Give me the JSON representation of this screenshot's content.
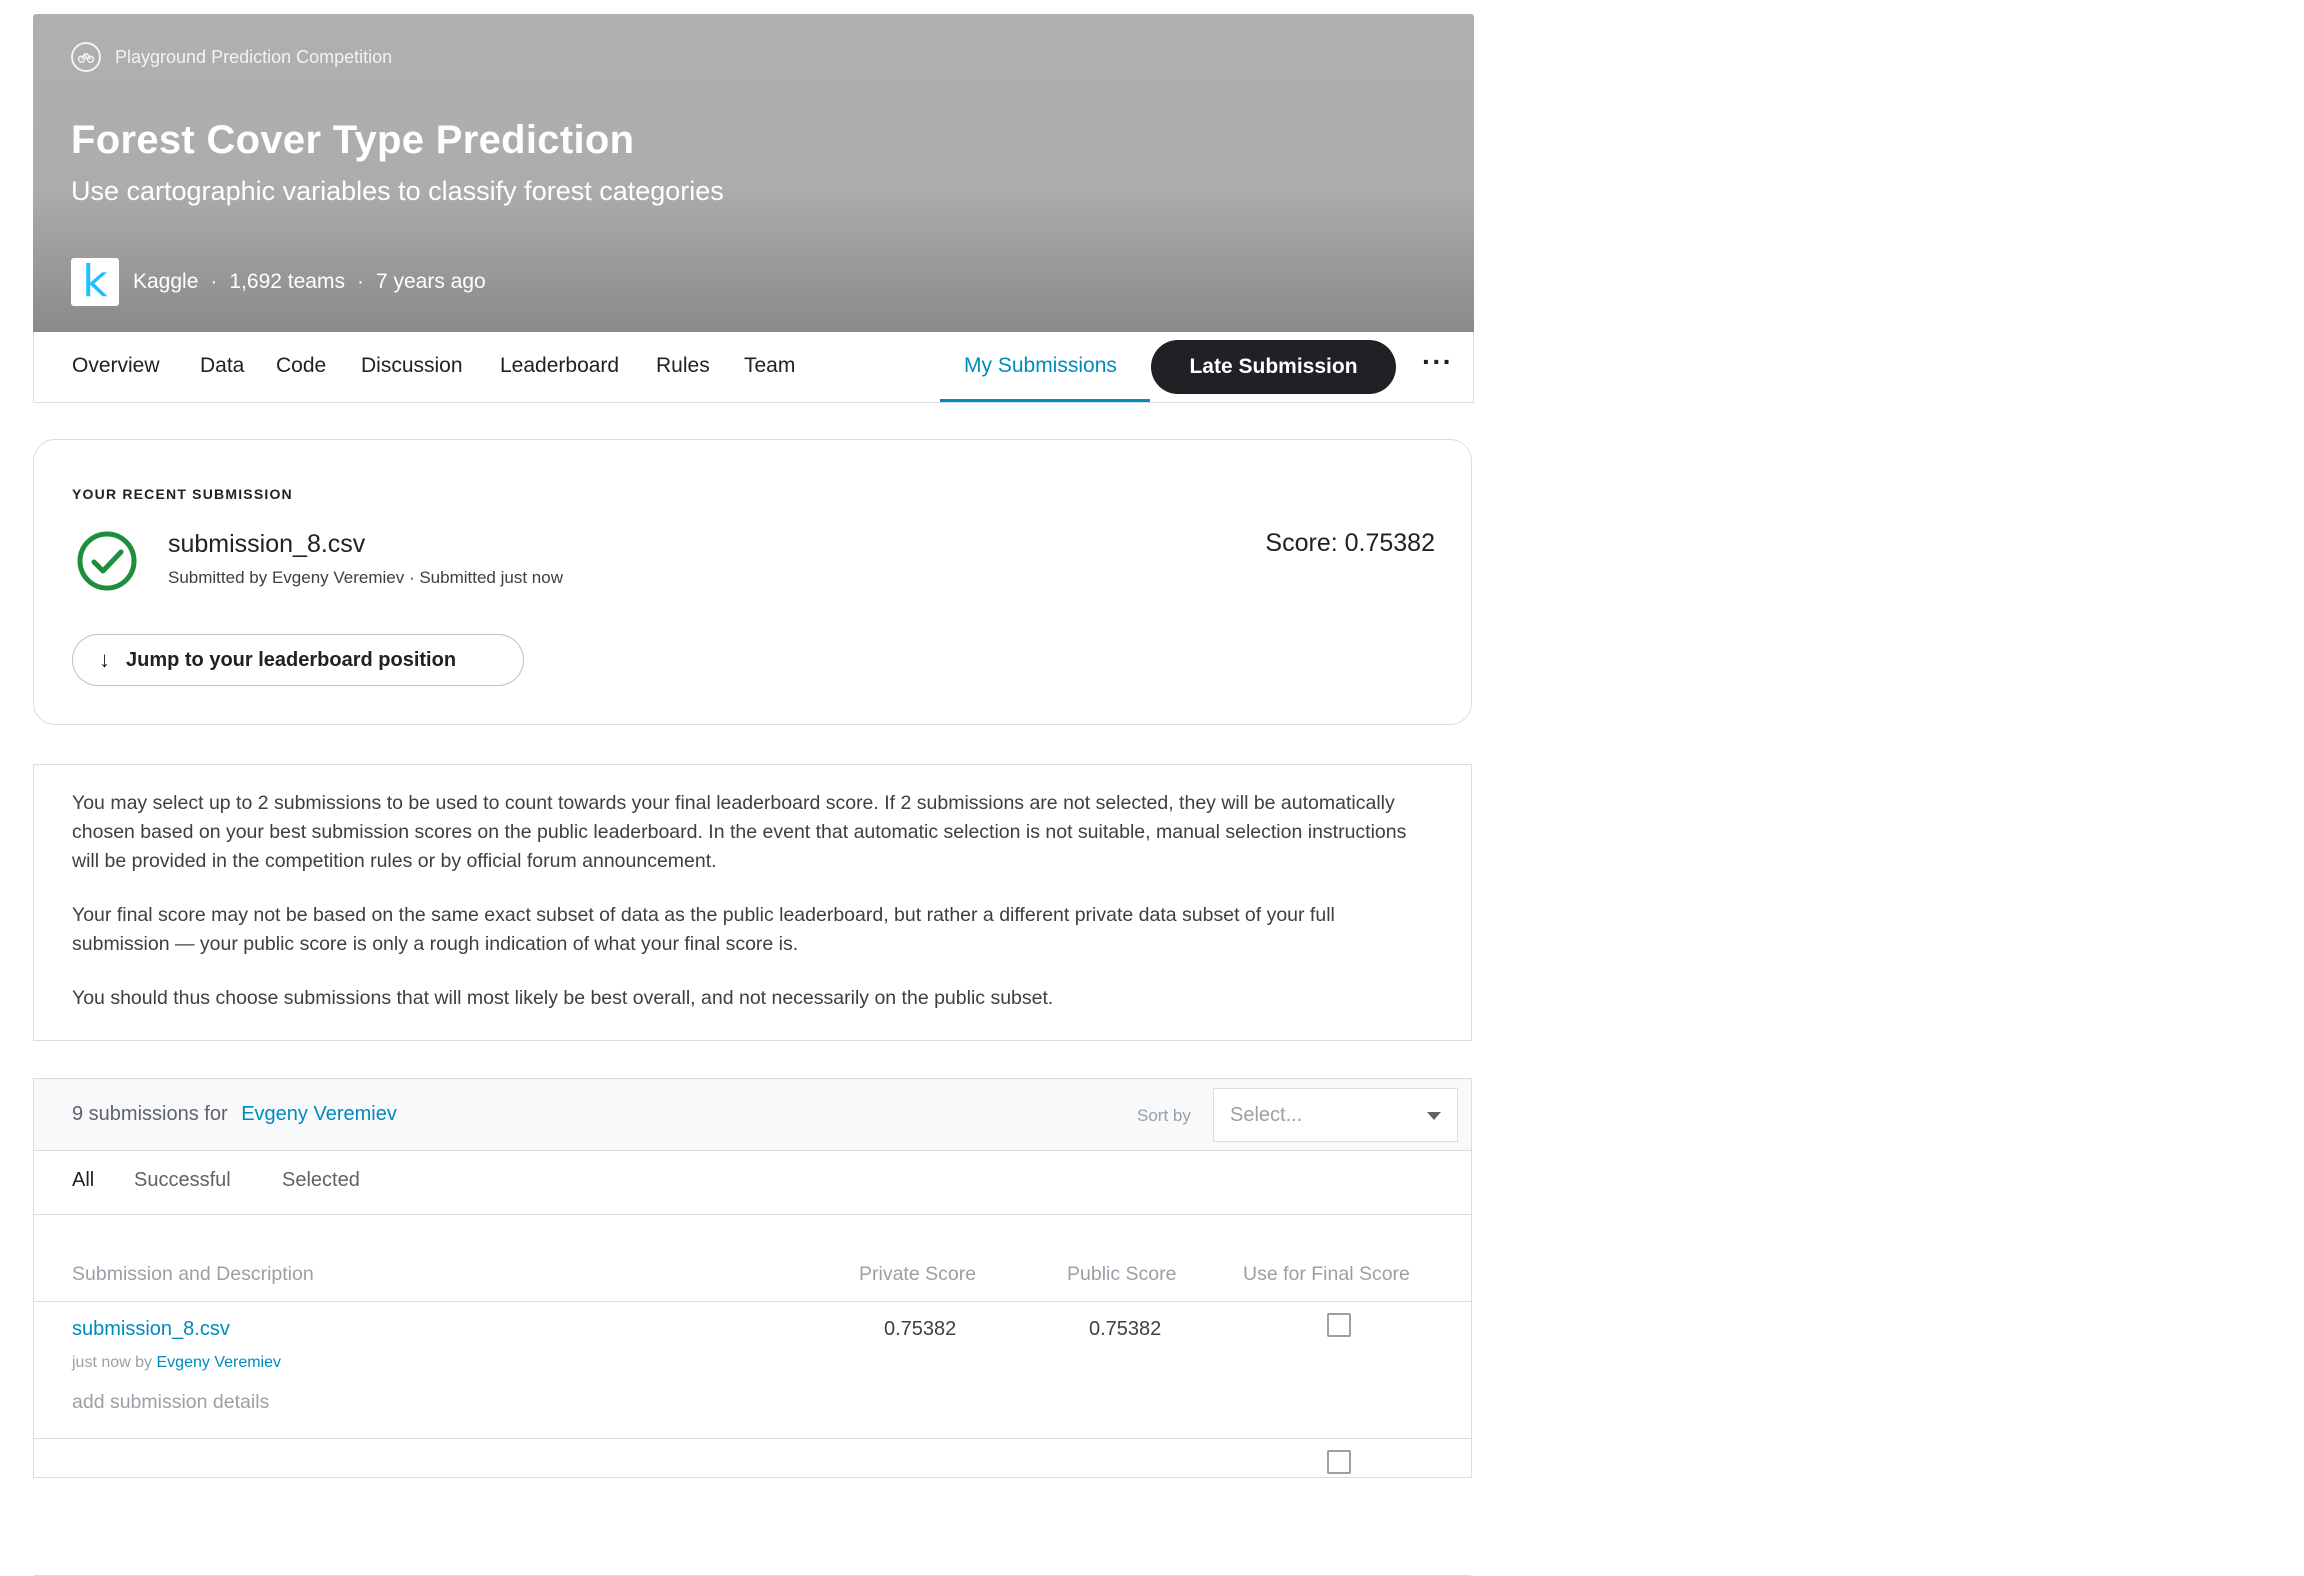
{
  "header": {
    "competition_type": "Playground Prediction Competition",
    "title": "Forest Cover Type Prediction",
    "subtitle": "Use cartographic variables to classify forest categories",
    "host_logo_letter": "k",
    "host": "Kaggle",
    "separator": "·",
    "teams": "1,692 teams",
    "age": "7 years ago"
  },
  "nav": {
    "tabs": [
      "Overview",
      "Data",
      "Code",
      "Discussion",
      "Leaderboard",
      "Rules",
      "Team"
    ],
    "active_tab": "My Submissions",
    "late_submission_label": "Late Submission",
    "more_label": "···"
  },
  "recent": {
    "label": "YOUR RECENT SUBMISSION",
    "file_name": "submission_8.csv",
    "submitted_text": "Submitted by Evgeny Veremiev · Submitted just now",
    "score": "Score: 0.75382",
    "jump_arrow": "↓",
    "jump_label": "Jump to your leaderboard position"
  },
  "info": {
    "p1": "You may select up to 2 submissions to be used to count towards your final leaderboard score. If 2 submissions are not selected, they will be automatically chosen based on your best submission scores on the public leaderboard. In the event that automatic selection is not suitable, manual selection instructions will be provided in the competition rules or by official forum announcement.",
    "p2": "Your final score may not be based on the same exact subset of data as the public leaderboard, but rather a different private data subset of your full submission — your public score is only a rough indication of what your final score is.",
    "p3": "You should thus choose submissions that will most likely be best overall, and not necessarily on the public subset."
  },
  "submissions": {
    "count_text": "9 submissions for",
    "user": "Evgeny Veremiev",
    "sort_label": "Sort by",
    "sort_placeholder": "Select...",
    "filters": [
      "All",
      "Successful",
      "Selected"
    ],
    "columns": [
      "Submission and Description",
      "Private Score",
      "Public Score",
      "Use for Final Score"
    ],
    "rows": [
      {
        "name": "submission_8.csv",
        "time": "just now by",
        "by": "Evgeny Veremiev",
        "details": "add submission details",
        "private_score": "0.75382",
        "public_score": "0.75382"
      }
    ]
  },
  "colors": {
    "accent": "#008abc",
    "success": "#1e8e3e",
    "dark_button": "#202124"
  }
}
